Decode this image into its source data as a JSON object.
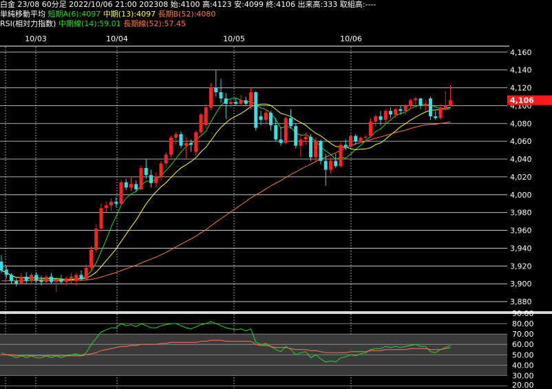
{
  "header": {
    "row1": "白金 23/08 60分足 2022/10/06 21:00 202308 始:4100 高:4123 安:4099 終:4106 出来高:333 取組高:----",
    "ma_title": "単純移動平均",
    "ma_a": "短期A(6):4097",
    "ma_mid": "中期(13):4097",
    "ma_b": "長期B(52):4080",
    "rsi_title": "RSI(相対力指数)",
    "rsi_mid": "中期線(14):59.01",
    "rsi_long": "長期線(52):57.45"
  },
  "colors": {
    "background": "#000000",
    "up_candle": "#ff2020",
    "down_candle": "#33e0e8",
    "ma_short": "#22dd22",
    "ma_mid": "#ffff44",
    "ma_long": "#ff7744",
    "grid": "#ffffff",
    "price_badge": "#ff1a1a"
  },
  "chart_data": [
    {
      "type": "candlestick",
      "x_labels": [
        "10/03",
        "10/04",
        "10/05",
        "10/06"
      ],
      "y_ticks": [
        "4,160",
        "4,140",
        "4,120",
        "4,100",
        "4,080",
        "4,060",
        "4,040",
        "4,020",
        "4,000",
        "3,980",
        "3,960",
        "3,940",
        "3,920",
        "3,900",
        "3,880"
      ],
      "ylim": [
        3870,
        4166
      ],
      "last_price_label": "4,106",
      "last_price": 4106,
      "candles": [
        {
          "o": 3925,
          "h": 3932,
          "l": 3912,
          "c": 3915
        },
        {
          "o": 3916,
          "h": 3920,
          "l": 3906,
          "c": 3910
        },
        {
          "o": 3910,
          "h": 3912,
          "l": 3900,
          "c": 3903
        },
        {
          "o": 3903,
          "h": 3906,
          "l": 3897,
          "c": 3900
        },
        {
          "o": 3900,
          "h": 3912,
          "l": 3899,
          "c": 3908
        },
        {
          "o": 3908,
          "h": 3913,
          "l": 3900,
          "c": 3903
        },
        {
          "o": 3903,
          "h": 3912,
          "l": 3900,
          "c": 3910
        },
        {
          "o": 3910,
          "h": 3913,
          "l": 3901,
          "c": 3904
        },
        {
          "o": 3904,
          "h": 3909,
          "l": 3898,
          "c": 3902
        },
        {
          "o": 3902,
          "h": 3910,
          "l": 3899,
          "c": 3908
        },
        {
          "o": 3908,
          "h": 3912,
          "l": 3900,
          "c": 3902
        },
        {
          "o": 3902,
          "h": 3908,
          "l": 3891,
          "c": 3905
        },
        {
          "o": 3905,
          "h": 3910,
          "l": 3900,
          "c": 3902
        },
        {
          "o": 3902,
          "h": 3908,
          "l": 3898,
          "c": 3906
        },
        {
          "o": 3906,
          "h": 3912,
          "l": 3900,
          "c": 3908
        },
        {
          "o": 3903,
          "h": 3912,
          "l": 3898,
          "c": 3910
        },
        {
          "o": 3910,
          "h": 3915,
          "l": 3903,
          "c": 3905
        },
        {
          "o": 3905,
          "h": 3922,
          "l": 3903,
          "c": 3918
        },
        {
          "o": 3918,
          "h": 3942,
          "l": 3915,
          "c": 3938
        },
        {
          "o": 3938,
          "h": 3967,
          "l": 3935,
          "c": 3962
        },
        {
          "o": 3962,
          "h": 3990,
          "l": 3958,
          "c": 3985
        },
        {
          "o": 3985,
          "h": 3992,
          "l": 3980,
          "c": 3988
        },
        {
          "o": 3988,
          "h": 3996,
          "l": 3982,
          "c": 3992
        },
        {
          "o": 3992,
          "h": 3997,
          "l": 3986,
          "c": 3990
        },
        {
          "o": 3990,
          "h": 4017,
          "l": 3988,
          "c": 4014
        },
        {
          "o": 4014,
          "h": 4018,
          "l": 4005,
          "c": 4008
        },
        {
          "o": 4008,
          "h": 4020,
          "l": 4004,
          "c": 4012
        },
        {
          "o": 4012,
          "h": 4016,
          "l": 4003,
          "c": 4006
        },
        {
          "o": 4006,
          "h": 4033,
          "l": 4005,
          "c": 4030
        },
        {
          "o": 4030,
          "h": 4040,
          "l": 4018,
          "c": 4022
        },
        {
          "o": 4022,
          "h": 4028,
          "l": 4008,
          "c": 4013
        },
        {
          "o": 4013,
          "h": 4025,
          "l": 4008,
          "c": 4020
        },
        {
          "o": 4020,
          "h": 4038,
          "l": 4016,
          "c": 4035
        },
        {
          "o": 4035,
          "h": 4048,
          "l": 4030,
          "c": 4045
        },
        {
          "o": 4045,
          "h": 4066,
          "l": 4042,
          "c": 4064
        },
        {
          "o": 4064,
          "h": 4071,
          "l": 4056,
          "c": 4068
        },
        {
          "o": 4068,
          "h": 4071,
          "l": 4052,
          "c": 4055
        },
        {
          "o": 4055,
          "h": 4065,
          "l": 4040,
          "c": 4058
        },
        {
          "o": 4058,
          "h": 4062,
          "l": 4048,
          "c": 4056
        },
        {
          "o": 4048,
          "h": 4072,
          "l": 4044,
          "c": 4070
        },
        {
          "o": 4070,
          "h": 4092,
          "l": 4066,
          "c": 4090
        },
        {
          "o": 4078,
          "h": 4102,
          "l": 4074,
          "c": 4098
        },
        {
          "o": 4098,
          "h": 4125,
          "l": 4095,
          "c": 4120
        },
        {
          "o": 4120,
          "h": 4140,
          "l": 4110,
          "c": 4115
        },
        {
          "o": 4115,
          "h": 4130,
          "l": 4103,
          "c": 4108
        },
        {
          "o": 4108,
          "h": 4114,
          "l": 4085,
          "c": 4102
        },
        {
          "o": 4102,
          "h": 4108,
          "l": 4098,
          "c": 4104
        },
        {
          "o": 4104,
          "h": 4108,
          "l": 4100,
          "c": 4102
        },
        {
          "o": 4102,
          "h": 4112,
          "l": 4100,
          "c": 4106
        },
        {
          "o": 4106,
          "h": 4110,
          "l": 4100,
          "c": 4102
        },
        {
          "o": 4100,
          "h": 4120,
          "l": 4096,
          "c": 4115
        },
        {
          "o": 4115,
          "h": 4116,
          "l": 4072,
          "c": 4075
        },
        {
          "o": 4088,
          "h": 4094,
          "l": 4078,
          "c": 4084
        },
        {
          "o": 4084,
          "h": 4096,
          "l": 4080,
          "c": 4092
        },
        {
          "o": 4092,
          "h": 4094,
          "l": 4072,
          "c": 4078
        },
        {
          "o": 4078,
          "h": 4086,
          "l": 4060,
          "c": 4062
        },
        {
          "o": 4062,
          "h": 4076,
          "l": 4055,
          "c": 4058
        },
        {
          "o": 4058,
          "h": 4088,
          "l": 4056,
          "c": 4086
        },
        {
          "o": 4086,
          "h": 4096,
          "l": 4074,
          "c": 4077
        },
        {
          "o": 4077,
          "h": 4080,
          "l": 4052,
          "c": 4055
        },
        {
          "o": 4055,
          "h": 4068,
          "l": 4042,
          "c": 4062
        },
        {
          "o": 4062,
          "h": 4070,
          "l": 4056,
          "c": 4065
        },
        {
          "o": 4065,
          "h": 4068,
          "l": 4038,
          "c": 4042
        },
        {
          "o": 4042,
          "h": 4064,
          "l": 4036,
          "c": 4060
        },
        {
          "o": 4060,
          "h": 4062,
          "l": 4034,
          "c": 4038
        },
        {
          "o": 4038,
          "h": 4046,
          "l": 4010,
          "c": 4028
        },
        {
          "o": 4028,
          "h": 4042,
          "l": 4024,
          "c": 4038
        },
        {
          "o": 4038,
          "h": 4046,
          "l": 4030,
          "c": 4032
        },
        {
          "o": 4032,
          "h": 4060,
          "l": 4030,
          "c": 4056
        },
        {
          "o": 4056,
          "h": 4062,
          "l": 4050,
          "c": 4054
        },
        {
          "o": 4054,
          "h": 4068,
          "l": 4052,
          "c": 4066
        },
        {
          "o": 4066,
          "h": 4068,
          "l": 4056,
          "c": 4060
        },
        {
          "o": 4060,
          "h": 4066,
          "l": 4058,
          "c": 4064
        },
        {
          "o": 4064,
          "h": 4067,
          "l": 4062,
          "c": 4065
        },
        {
          "o": 4066,
          "h": 4086,
          "l": 4064,
          "c": 4082
        },
        {
          "o": 4082,
          "h": 4090,
          "l": 4076,
          "c": 4088
        },
        {
          "o": 4088,
          "h": 4094,
          "l": 4078,
          "c": 4084
        },
        {
          "o": 4084,
          "h": 4096,
          "l": 4080,
          "c": 4094
        },
        {
          "o": 4094,
          "h": 4098,
          "l": 4086,
          "c": 4090
        },
        {
          "o": 4090,
          "h": 4098,
          "l": 4086,
          "c": 4096
        },
        {
          "o": 4096,
          "h": 4100,
          "l": 4090,
          "c": 4094
        },
        {
          "o": 4094,
          "h": 4102,
          "l": 4090,
          "c": 4100
        },
        {
          "o": 4100,
          "h": 4108,
          "l": 4096,
          "c": 4106
        },
        {
          "o": 4106,
          "h": 4110,
          "l": 4098,
          "c": 4108
        },
        {
          "o": 4108,
          "h": 4109,
          "l": 4096,
          "c": 4100
        },
        {
          "o": 4100,
          "h": 4106,
          "l": 4094,
          "c": 4102
        },
        {
          "o": 4108,
          "h": 4110,
          "l": 4084,
          "c": 4088
        },
        {
          "o": 4088,
          "h": 4094,
          "l": 4084,
          "c": 4086
        },
        {
          "o": 4086,
          "h": 4102,
          "l": 4084,
          "c": 4098
        },
        {
          "o": 4096,
          "h": 4116,
          "l": 4094,
          "c": 4100
        },
        {
          "o": 4100,
          "h": 4123,
          "l": 4099,
          "c": 4106
        }
      ]
    },
    {
      "type": "line",
      "name": "RSI",
      "y_ticks": [
        "90.00",
        "80.00",
        "70.00",
        "60.00",
        "50.00",
        "40.00",
        "30.00",
        "20.00"
      ],
      "ylim": [
        17,
        90
      ],
      "bands": [
        [
          30,
          70
        ]
      ],
      "series": [
        {
          "name": "中期線(14)",
          "values": [
            52,
            50,
            49,
            47,
            49,
            47,
            49,
            47,
            47,
            49,
            47,
            49,
            47,
            49,
            50,
            51,
            49,
            52,
            60,
            66,
            72,
            74,
            76,
            76,
            80,
            78,
            79,
            77,
            80,
            78,
            76,
            76,
            78,
            79,
            80,
            80,
            78,
            76,
            75,
            77,
            79,
            80,
            82,
            80,
            78,
            76,
            75,
            74,
            75,
            73,
            75,
            62,
            60,
            61,
            58,
            55,
            53,
            58,
            55,
            50,
            52,
            53,
            47,
            50,
            46,
            43,
            44,
            43,
            47,
            48,
            50,
            49,
            51,
            52,
            55,
            56,
            56,
            58,
            57,
            58,
            57,
            58,
            59,
            60,
            58,
            58,
            53,
            52,
            55,
            57,
            59
          ]
        },
        {
          "name": "長期線(52)",
          "values": [
            50,
            50,
            50,
            49,
            49,
            49,
            49,
            49,
            49,
            49,
            49,
            49,
            49,
            49,
            49,
            49,
            49,
            50,
            51,
            52,
            54,
            55,
            56,
            57,
            58,
            58,
            59,
            59,
            60,
            60,
            60,
            60,
            61,
            61,
            62,
            62,
            62,
            62,
            62,
            62,
            63,
            63,
            64,
            64,
            64,
            63,
            63,
            63,
            63,
            63,
            63,
            60,
            59,
            59,
            58,
            57,
            57,
            57,
            56,
            55,
            55,
            55,
            54,
            54,
            53,
            52,
            52,
            52,
            52,
            52,
            53,
            53,
            53,
            53,
            54,
            54,
            54,
            55,
            55,
            55,
            55,
            55,
            56,
            56,
            56,
            56,
            55,
            55,
            55,
            56,
            57
          ]
        }
      ]
    }
  ]
}
